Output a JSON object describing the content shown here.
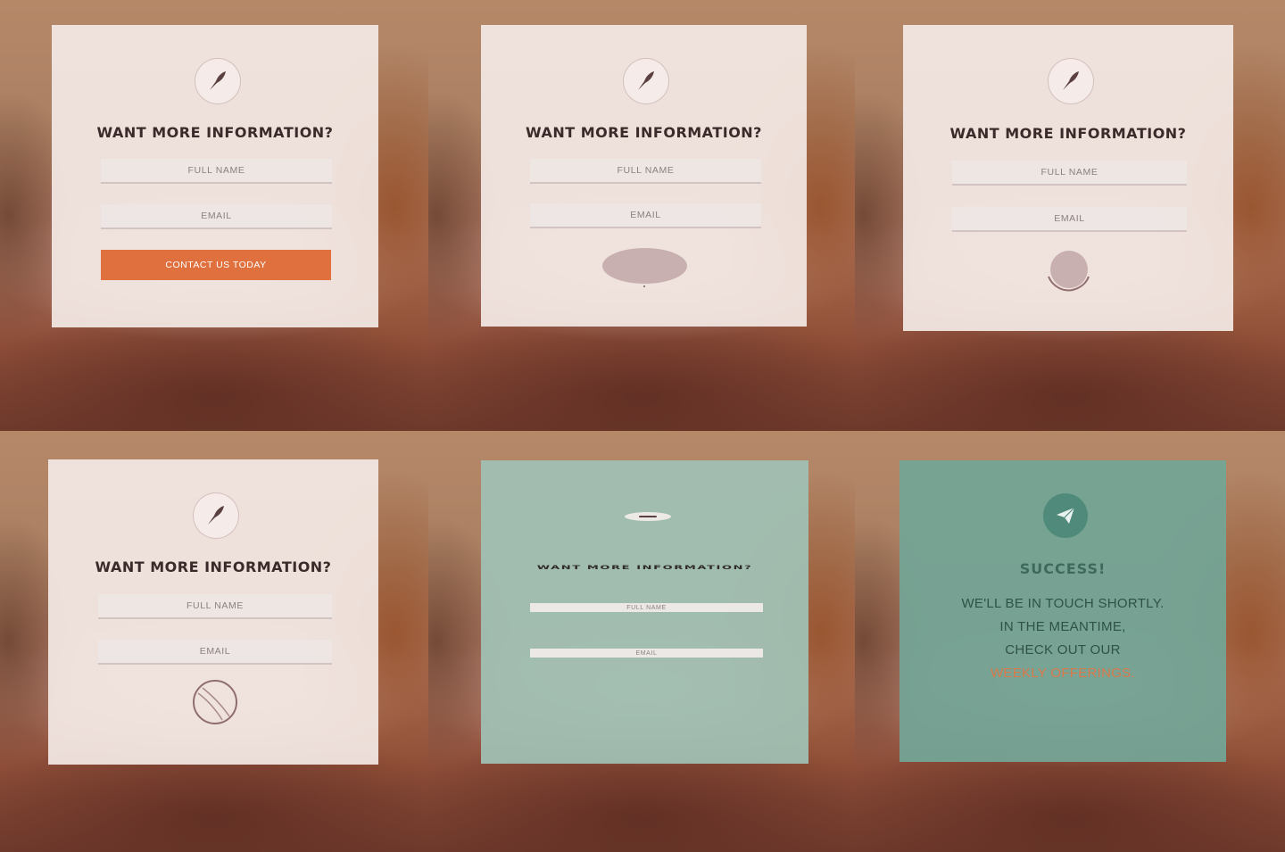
{
  "form": {
    "title": "WANT MORE INFORMATION?",
    "full_name_placeholder": "FULL NAME",
    "email_placeholder": "EMAIL",
    "submit_label": "CONTACT US TODAY",
    "icon": "feather-icon"
  },
  "success": {
    "icon": "paper-plane-icon",
    "title": "SUCCESS!",
    "line1": "WE'LL BE IN TOUCH SHORTLY.",
    "line2": "IN THE MEANTIME,",
    "line3": "CHECK OUT OUR",
    "link": "WEEKLY OFFERINGS."
  },
  "colors": {
    "accent": "#e0703d",
    "card": "#f3e8e4",
    "teal": "#a0c2b5",
    "teal_dark": "#74a496",
    "title_text": "#3b2a2a",
    "success_text": "#3e6a5d"
  }
}
